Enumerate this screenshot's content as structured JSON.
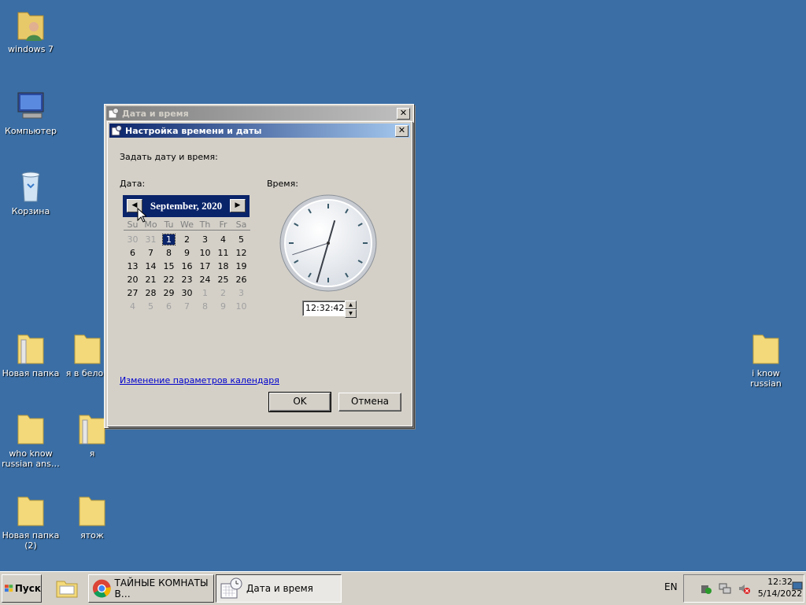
{
  "desktop": {
    "icons": [
      {
        "label": "windows 7",
        "icon": "user-folder-icon"
      },
      {
        "label": "Компьютер",
        "icon": "computer-icon"
      },
      {
        "label": "Корзина",
        "icon": "recycle-bin-icon"
      },
      {
        "label": "Новая папка",
        "icon": "folder-icon"
      },
      {
        "label": "я в белор",
        "icon": "folder-icon"
      },
      {
        "label": "who know russian ans…",
        "icon": "folder-icon"
      },
      {
        "label": "я",
        "icon": "folder-icon"
      },
      {
        "label": "Новая папка (2)",
        "icon": "folder-icon"
      },
      {
        "label": "ятож",
        "icon": "folder-icon"
      },
      {
        "label": "i know russian",
        "icon": "folder-icon"
      }
    ]
  },
  "parent_window": {
    "title": "Дата и время",
    "close": "✕"
  },
  "dialog": {
    "title": "Настройка времени и даты",
    "close": "✕",
    "instruction": "Задать дату и время:",
    "date_label": "Дата:",
    "time_label": "Время:",
    "calendar": {
      "month_year": "September, 2020",
      "prev": "◀",
      "next": "▶",
      "weekdays": [
        "Su",
        "Mo",
        "Tu",
        "We",
        "Th",
        "Fr",
        "Sa"
      ],
      "weeks": [
        [
          {
            "d": "30",
            "dim": true
          },
          {
            "d": "31",
            "dim": true
          },
          {
            "d": "1",
            "sel": true
          },
          {
            "d": "2"
          },
          {
            "d": "3"
          },
          {
            "d": "4"
          },
          {
            "d": "5"
          }
        ],
        [
          {
            "d": "6"
          },
          {
            "d": "7"
          },
          {
            "d": "8"
          },
          {
            "d": "9"
          },
          {
            "d": "10"
          },
          {
            "d": "11"
          },
          {
            "d": "12"
          }
        ],
        [
          {
            "d": "13"
          },
          {
            "d": "14"
          },
          {
            "d": "15"
          },
          {
            "d": "16"
          },
          {
            "d": "17"
          },
          {
            "d": "18"
          },
          {
            "d": "19"
          }
        ],
        [
          {
            "d": "20"
          },
          {
            "d": "21"
          },
          {
            "d": "22"
          },
          {
            "d": "23"
          },
          {
            "d": "24"
          },
          {
            "d": "25"
          },
          {
            "d": "26"
          }
        ],
        [
          {
            "d": "27"
          },
          {
            "d": "28"
          },
          {
            "d": "29"
          },
          {
            "d": "30"
          },
          {
            "d": "1",
            "dim": true
          },
          {
            "d": "2",
            "dim": true
          },
          {
            "d": "3",
            "dim": true
          }
        ],
        [
          {
            "d": "4",
            "dim": true
          },
          {
            "d": "5",
            "dim": true
          },
          {
            "d": "6",
            "dim": true
          },
          {
            "d": "7",
            "dim": true
          },
          {
            "d": "8",
            "dim": true
          },
          {
            "d": "9",
            "dim": true
          },
          {
            "d": "10",
            "dim": true
          }
        ]
      ]
    },
    "clock": {
      "hours": 12,
      "minutes": 32,
      "seconds": 42
    },
    "time_value": "12:32:42",
    "calendar_link": "Изменение параметров календаря",
    "ok_label": "OK",
    "cancel_label": "Отмена"
  },
  "taskbar": {
    "start_label": "Пуск",
    "tasks": [
      {
        "label": "ТАЙНЫЕ КОМНАТЫ В…",
        "icon": "chrome-icon"
      },
      {
        "label": "Дата и время",
        "icon": "clock-calendar-icon"
      }
    ],
    "language": "EN",
    "time": "12:32",
    "date": "5/14/2022"
  },
  "colors": {
    "desktop": "#3a6ea5",
    "active_title": "#0a246a",
    "window_face": "#d4d0c8"
  }
}
